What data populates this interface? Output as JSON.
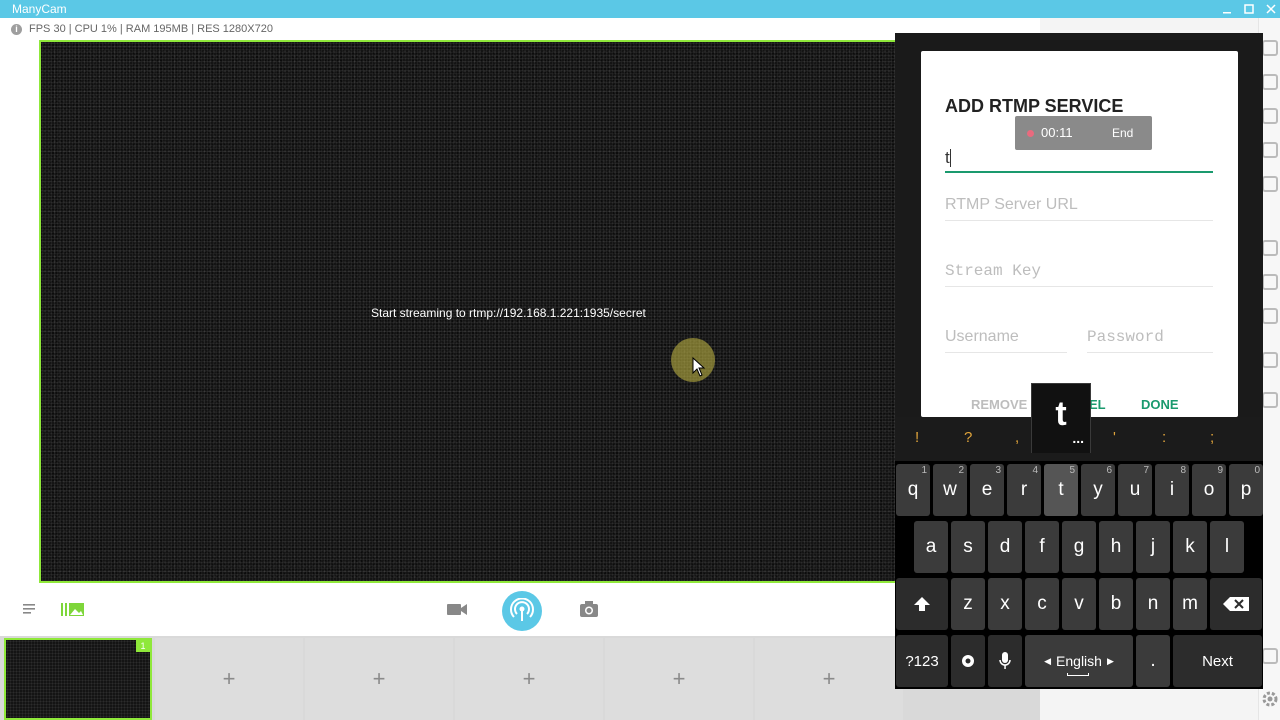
{
  "window": {
    "title": "ManyCam"
  },
  "stats": {
    "text": "FPS 30 | CPU 1% | RAM 195MB | RES 1280X720",
    "info": "i"
  },
  "preview": {
    "overlay_text": "Start streaming to rtmp://192.168.1.221:1935/secret"
  },
  "scenes": {
    "active_badge": "1",
    "add_label": "+"
  },
  "dialog": {
    "title": "ADD RTMP SERVICE",
    "service_name_value": "t",
    "server_url_placeholder": "RTMP Server URL",
    "stream_key_placeholder": "Stream Key",
    "username_placeholder": "Username",
    "password_placeholder": "Password",
    "remove_label": "REMOVE",
    "cancel_label_visible": "EL",
    "done_label": "DONE",
    "accent": "#1a9a6e"
  },
  "recording": {
    "time": "00:11",
    "end_label": "End"
  },
  "keyboard": {
    "popup_key": "t",
    "popup_dots": "...",
    "suggestions": [
      "!",
      "?",
      ",",
      "'",
      ":",
      ";"
    ],
    "row1": [
      {
        "k": "q",
        "h": "1"
      },
      {
        "k": "w",
        "h": "2"
      },
      {
        "k": "e",
        "h": "3"
      },
      {
        "k": "r",
        "h": "4"
      },
      {
        "k": "t",
        "h": "5"
      },
      {
        "k": "y",
        "h": "6"
      },
      {
        "k": "u",
        "h": "7"
      },
      {
        "k": "i",
        "h": "8"
      },
      {
        "k": "o",
        "h": "9"
      },
      {
        "k": "p",
        "h": "0"
      }
    ],
    "row2": [
      "a",
      "s",
      "d",
      "f",
      "g",
      "h",
      "j",
      "k",
      "l"
    ],
    "row3": [
      "z",
      "x",
      "c",
      "v",
      "b",
      "n",
      "m"
    ],
    "sym_label": "?123",
    "space_label": "English",
    "period_label": ".",
    "next_label": "Next"
  }
}
